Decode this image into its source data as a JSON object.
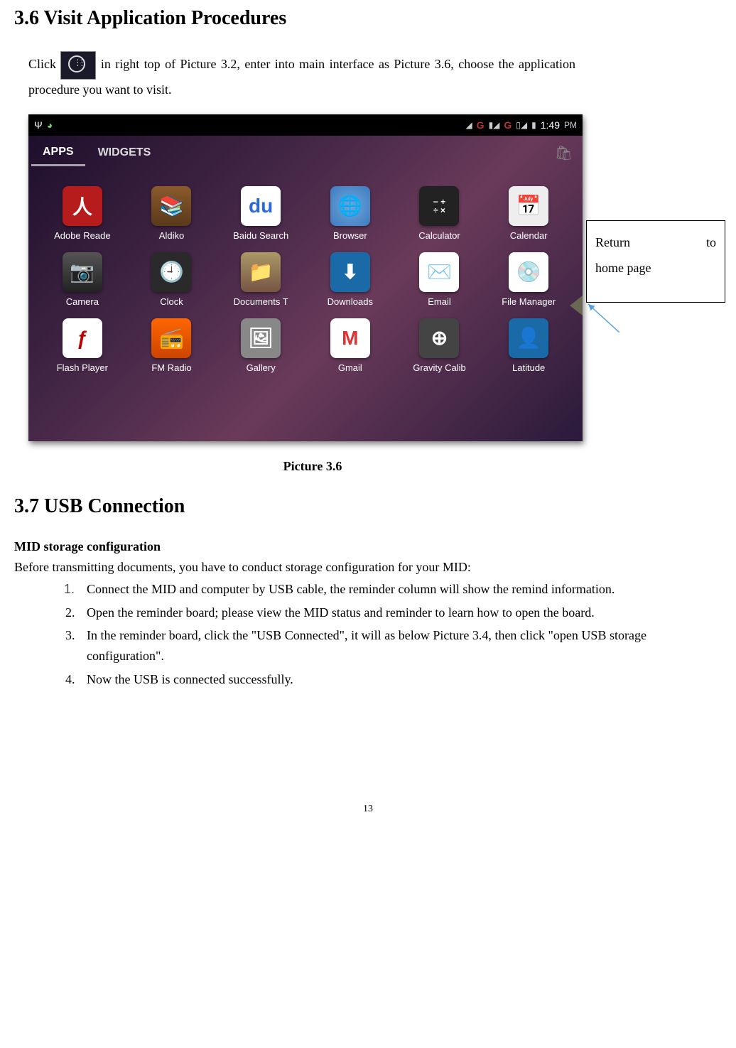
{
  "section36": {
    "heading": "3.6 Visit Application Procedures",
    "para_prefix": "  Click ",
    "para_suffix": "in right top of Picture 3.2, enter into main interface as Picture 3.6, choose the application procedure you want to visit."
  },
  "screenshot": {
    "status": {
      "time": "1:49",
      "ampm": "PM",
      "g1": "G",
      "g2": "G"
    },
    "tabs": {
      "apps": "APPS",
      "widgets": "WIDGETS"
    },
    "apps": {
      "r1": [
        "Adobe Reade",
        "Aldiko",
        "Baidu Search",
        "Browser",
        "Calculator",
        "Calendar"
      ],
      "r2": [
        "Camera",
        "Clock",
        "Documents T",
        "Downloads",
        "Email",
        "File Manager"
      ],
      "r3": [
        "Flash Player",
        "FM Radio",
        "Gallery",
        "Gmail",
        "Gravity Calib",
        "Latitude"
      ]
    },
    "caption": "Picture 3.6"
  },
  "callout": {
    "line1a": "Return",
    "line1b": "to",
    "line2": "home page"
  },
  "section37": {
    "heading": "3.7 USB Connection",
    "sub": "MID storage configuration",
    "intro": "Before transmitting documents, you have to conduct storage configuration for your MID:",
    "steps": [
      "Connect the MID and computer by USB cable, the reminder column will show the remind information.",
      "Open the reminder board; please view the MID status and reminder to learn how to open the board.",
      "In the reminder board, click the \"USB Connected\", it will as below Picture 3.4, then click \"open USB storage configuration\".",
      "Now the USB is connected successfully."
    ]
  },
  "page_number": "13"
}
